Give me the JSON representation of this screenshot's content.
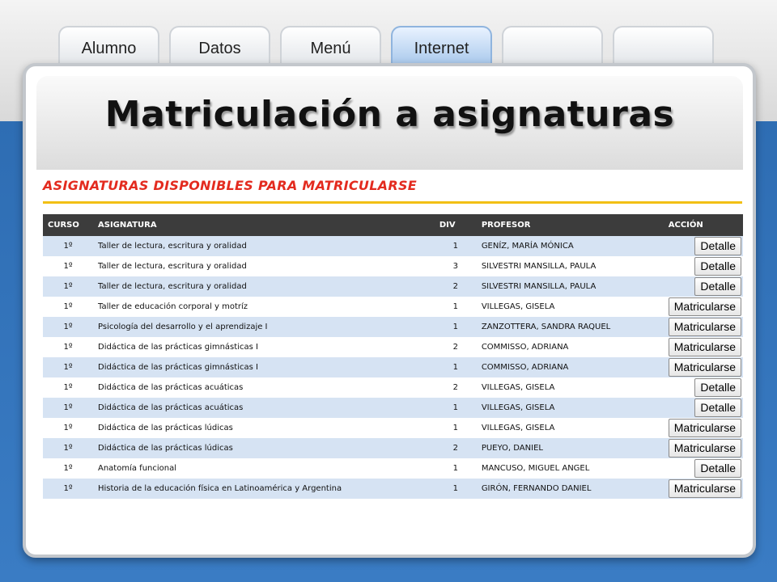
{
  "tabs": [
    {
      "label": "Alumno",
      "active": false
    },
    {
      "label": "Datos",
      "active": false
    },
    {
      "label": "Menú",
      "active": false
    },
    {
      "label": "Internet",
      "active": true
    },
    {
      "label": "",
      "active": false
    },
    {
      "label": "",
      "active": false
    }
  ],
  "page": {
    "title": "Matriculación a asignaturas"
  },
  "section": {
    "heading": "ASIGNATURAS DISPONIBLES PARA MATRICULARSE"
  },
  "colors": {
    "heading": "#e32b1f",
    "rule": "#f2c014",
    "header_bg": "#3c3c3c",
    "row_alt": "#d6e3f3",
    "background_blue": "#2e6db3"
  },
  "table": {
    "headers": {
      "curso": "CURSO",
      "asignatura": "ASIGNATURA",
      "div": "DIV",
      "profesor": "PROFESOR",
      "accion": "ACCIÓN"
    },
    "rows": [
      {
        "curso": "1º",
        "asignatura": "Taller de lectura, escritura y oralidad",
        "div": "1",
        "profesor": "GENÍZ, MARÍA MÓNICA",
        "accion": "Detalle"
      },
      {
        "curso": "1º",
        "asignatura": "Taller de lectura, escritura y oralidad",
        "div": "3",
        "profesor": "SILVESTRI MANSILLA, PAULA",
        "accion": "Detalle"
      },
      {
        "curso": "1º",
        "asignatura": "Taller de lectura, escritura y oralidad",
        "div": "2",
        "profesor": "SILVESTRI MANSILLA, PAULA",
        "accion": "Detalle"
      },
      {
        "curso": "1º",
        "asignatura": "Taller de educación corporal y motríz",
        "div": "1",
        "profesor": "VILLEGAS, GISELA",
        "accion": "Matricularse"
      },
      {
        "curso": "1º",
        "asignatura": "Psicología del desarrollo y el aprendizaje I",
        "div": "1",
        "profesor": "ZANZOTTERA, SANDRA RAQUEL",
        "accion": "Matricularse"
      },
      {
        "curso": "1º",
        "asignatura": "Didáctica de las prácticas gimnásticas I",
        "div": "2",
        "profesor": "COMMISSO, ADRIANA",
        "accion": "Matricularse"
      },
      {
        "curso": "1º",
        "asignatura": "Didáctica de las prácticas gimnásticas I",
        "div": "1",
        "profesor": "COMMISSO, ADRIANA",
        "accion": "Matricularse"
      },
      {
        "curso": "1º",
        "asignatura": "Didáctica de las prácticas acuáticas",
        "div": "2",
        "profesor": "VILLEGAS, GISELA",
        "accion": "Detalle"
      },
      {
        "curso": "1º",
        "asignatura": "Didáctica de las prácticas acuáticas",
        "div": "1",
        "profesor": "VILLEGAS, GISELA",
        "accion": "Detalle"
      },
      {
        "curso": "1º",
        "asignatura": "Didáctica de las prácticas lúdicas",
        "div": "1",
        "profesor": "VILLEGAS, GISELA",
        "accion": "Matricularse"
      },
      {
        "curso": "1º",
        "asignatura": "Didáctica de las prácticas lúdicas",
        "div": "2",
        "profesor": "PUEYO, DANIEL",
        "accion": "Matricularse"
      },
      {
        "curso": "1º",
        "asignatura": "Anatomía funcional",
        "div": "1",
        "profesor": "MANCUSO, MIGUEL ANGEL",
        "accion": "Detalle"
      },
      {
        "curso": "1º",
        "asignatura": "Historia de la educación física en Latinoamérica y Argentina",
        "div": "1",
        "profesor": "GIRÓN, FERNANDO DANIEL",
        "accion": "Matricularse"
      }
    ]
  }
}
